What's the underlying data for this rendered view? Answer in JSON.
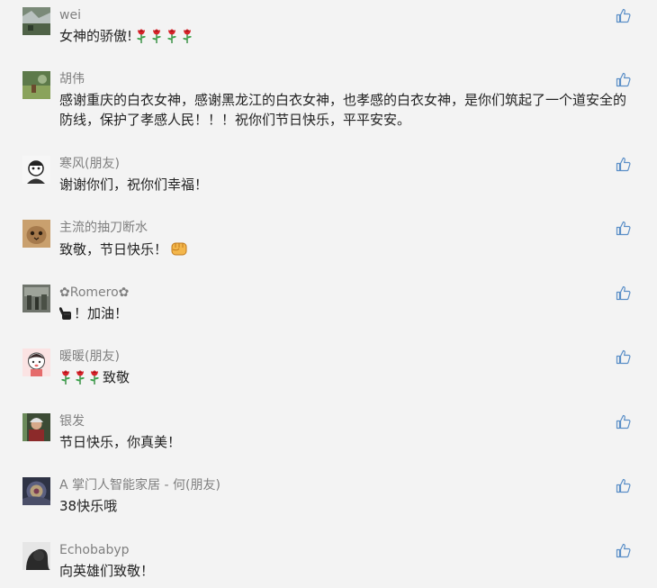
{
  "comments": [
    {
      "name": "wei",
      "text": "女神的骄傲!",
      "emoji_after": [
        "rose",
        "rose",
        "rose",
        "rose"
      ],
      "avatar": "avatar-photo"
    },
    {
      "name": "胡伟",
      "text": "感谢重庆的白衣女神，感谢黑龙江的白衣女神，也孝感的白衣女神，是你们筑起了一个道安全的防线，保护了孝感人民！！！祝你们节日快乐，平平安安。",
      "emoji_after": [],
      "avatar": "avatar-photo"
    },
    {
      "name": "寒风(朋友)",
      "text": "谢谢你们，祝你们幸福！",
      "emoji_after": [],
      "avatar": "avatar-cartoon"
    },
    {
      "name": "主流的抽刀断水",
      "text": "致敬，节日快乐！",
      "emoji_after": [
        "fist"
      ],
      "avatar": "avatar-cat"
    },
    {
      "name": "✿Romero✿",
      "text": "！加油！",
      "emoji_before": [
        "pointing-finger"
      ],
      "emoji_after": [],
      "avatar": "avatar-photo"
    },
    {
      "name": "暖暖(朋友)",
      "text": "致敬",
      "emoji_before": [
        "rose",
        "rose",
        "rose"
      ],
      "emoji_after": [],
      "avatar": "avatar-cartoon"
    },
    {
      "name": "银发",
      "text": "节日快乐，你真美！",
      "emoji_after": [],
      "avatar": "avatar-photo"
    },
    {
      "name": "A 掌门人智能家居 - 何(朋友)",
      "text": "38快乐哦",
      "emoji_after": [],
      "avatar": "avatar-photo"
    },
    {
      "name": "Echobabyp",
      "text": "向英雄们致敬！",
      "emoji_after": [],
      "avatar": "avatar-silhouette"
    }
  ],
  "like_icon": "thumbs-up-icon",
  "colors": {
    "background": "#f3f3f3",
    "name": "#7f7f7f",
    "text": "#222222",
    "like": "#5b8fc7"
  }
}
